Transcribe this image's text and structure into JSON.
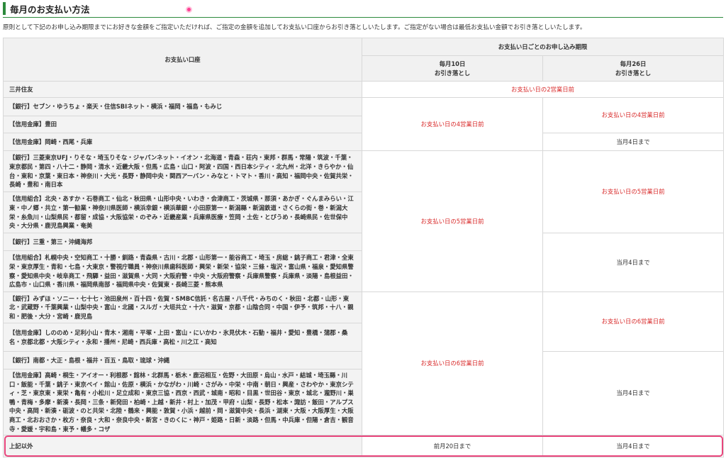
{
  "section": {
    "title": "毎月のお支払い方法",
    "intro": "原則として下記のお申し込み期限までにお好きな金額をご指定いただければ、ご指定の金額を追加してお支払い口座からお引き落としいたします。ご指定がない場合は最低お支払い金額でお引き落としいたします。"
  },
  "table": {
    "header_account": "お支払い口座",
    "header_deadline": "お支払い日ごとのお申し込み期限",
    "header_10": "毎月10日\nお引き落とし",
    "header_26": "毎月26日\nお引き落とし",
    "rows": [
      "三井住友",
      "【銀行】セブン・ゆうちょ・楽天・住信SBIネット・横浜・福岡・福島・もみじ",
      "【信用金庫】豊田",
      "【信用金庫】岡崎・西尾・兵庫",
      "【銀行】三菱東京UFJ・りそな・埼玉りそな・ジャパンネット・イオン・北海道・青森・荘内・東邦・群馬・常陽・筑波・千葉・東京都民・第四・八十二・静岡・清水・近畿大阪・但馬・広島・山口・阿波・四国・西日本シティ・北九州・北洋・きらやか・仙台・東和・京葉・東日本・神奈川・大光・長野・静岡中央・関西アーバン・みなと・トマト・香川・高知・福岡中央・佐賀共栄・長崎・豊和・南日本",
      "【信用組合】北央・あすか・石巻商工・仙北・秋田県・山形中央・いわき・会津商工・茨城県・那須・あかぎ・ぐんまみらい・江東・中ノ郷・共立・第一勧業・神奈川県医師・横浜幸銀・横浜華銀・小田原第一・新潟縣・新潟鉄道・さくらの街・巻・新潟大栄・糸魚川・山梨県民・都留・成協・大阪協栄・のぞみ・近畿産業・兵庫県医療・笠岡・土佐・とびうめ・長崎県民・佐世保中央・大分県・鹿児島興業・奄美",
      "【銀行】三重・第三・沖縄海邦",
      "【信用組合】札幌中央・空知商工・十勝・釧路・青森県・古川・北郡・山形第一・能谷商工・埼玉・房総・銚子商工・君津・全東栄・東京厚生・青和・七島・大東京・警視庁職員・神奈川県歯科医師・興栄・新栄・協栄・三條・塩沢・富山県・福泉・愛知県警察・愛知県中央・岐阜商工・飛驒・益田・滋賀県・大同・大阪府警・中央・大阪府警察・兵庫県警察・兵庫県・淡陽・島根益田・広島市・山口県・香川県・福岡県南部・福岡県中央・佐賀東・長崎三菱・熊本県",
      "【銀行】みずほ・ソニー・七十七・池田泉州・百十四・佐賀・SMBC信託・名古屋・八千代・みちのく・秋田・北都・山形・東北・武蔵野・千葉興業・山梨中央・富山・北國・スルガ・大垣共立・十六・滋賀・京都・山陰合同・中国・伊予・筑邦・十八・親和・肥後・大分・宮崎・鹿児島",
      "【信用金庫】しののめ・足利小山・青木・湘南・平塚・上田・富山・にいかわ・氷見伏木・石動・福井・愛知・豊橋・蒲郡・桑名・京都北都・大阪シティ・永和・播州・尼崎・西兵庫・高松・川之江・高知",
      "【銀行】南都・大正・島根・福井・百五・鳥取・琉球・沖縄",
      "【信用金庫】高崎・桐生・アイオー・利根郡・館林・北群馬・栃木・鹿沼相互・佐野・大田原・烏山・水戸・結城・埼玉縣・川口・飯能・千葉・銚子・東京ベイ・館山・佐原・横浜・かながわ・川崎・さがみ・中栄・中南・朝日・興産・さわやか・東京シティ・芝・東京東・東栄・亀有・小松川・足立成和・東京三協・西京・西武・城南・昭和・目黒・世田谷・東京・城北・瀧野川・巣鴨・青梅・多摩・新湊・長岡・三条・新発田・柏崎・上越・新井・村上・加茂・甲府・山梨・長野・松本・諏訪・飯田・アルプス中央・高岡・新湊・砺波・のと共栄・北陸・鶴来・興能・敦賀・小浜・越前・岡・滋賀中央・長浜・湖東・大阪・大阪厚生・大阪商工・北おおさか・枚方・奈良・大和・奈良中央・新宮・きのくに・神戸・姫路・日新・淡路・但馬・中兵庫・但陽・倉吉・観音寺・愛媛・宇和島・東予・幡多・コザ",
      "上記以外"
    ],
    "deadline_2": "お支払い日の2営業日前",
    "deadline_4": "お支払い日の4営業日前",
    "deadline_5": "お支払い日の5営業日前",
    "deadline_6": "お支払い日の6営業日前",
    "deadline_4days": "当月4日まで",
    "deadline_prev20": "前月20日まで"
  }
}
